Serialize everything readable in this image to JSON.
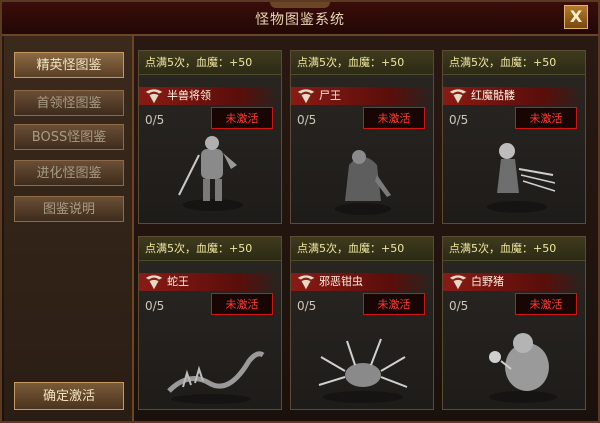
{
  "window": {
    "title": "怪物图鉴系统",
    "close_label": "X"
  },
  "sidebar": {
    "items": [
      {
        "label": "精英怪图鉴",
        "active": true
      },
      {
        "label": "首领怪图鉴",
        "active": false
      },
      {
        "label": "BOSS怪图鉴",
        "active": false
      },
      {
        "label": "进化怪图鉴",
        "active": false
      },
      {
        "label": "图鉴说明",
        "active": false
      }
    ],
    "confirm_label": "确定激活"
  },
  "cards": [
    {
      "bonus": "点满5次，血魔：+50",
      "name": "半兽将领",
      "count": "0/5",
      "status": "未激活",
      "icon": "half-orc-general-icon"
    },
    {
      "bonus": "点满5次，血魔：+50",
      "name": "尸王",
      "count": "0/5",
      "status": "未激活",
      "icon": "corpse-king-icon"
    },
    {
      "bonus": "点满5次，血魔：+50",
      "name": "红魔骷髅",
      "count": "0/5",
      "status": "未激活",
      "icon": "red-skeleton-icon"
    },
    {
      "bonus": "点满5次，血魔：+50",
      "name": "蛇王",
      "count": "0/5",
      "status": "未激活",
      "icon": "snake-king-icon"
    },
    {
      "bonus": "点满5次，血魔：+50",
      "name": "邪恶钳虫",
      "count": "0/5",
      "status": "未激活",
      "icon": "evil-pincer-bug-icon"
    },
    {
      "bonus": "点满5次，血魔：+50",
      "name": "白野猪",
      "count": "0/5",
      "status": "未激活",
      "icon": "white-boar-icon"
    }
  ],
  "colors": {
    "status_red": "#ff3a2e",
    "bonus_text": "#f0e7a0",
    "accent_gold": "#c49a62"
  }
}
